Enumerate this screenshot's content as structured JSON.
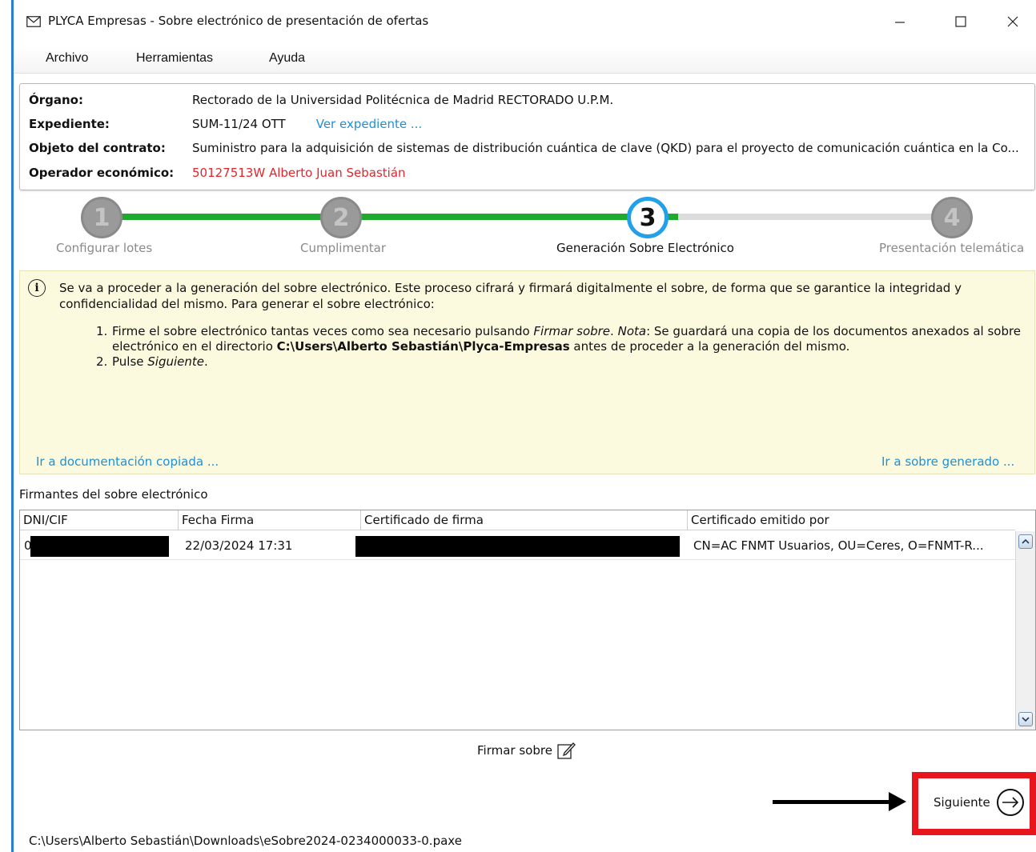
{
  "window": {
    "title": "PLYCA Empresas - Sobre electrónico de presentación de ofertas",
    "app_icon": "envelope-icon",
    "controls": [
      "minimize-icon",
      "maximize-icon",
      "close-icon"
    ]
  },
  "menu": {
    "items": [
      "Archivo",
      "Herramientas",
      "Ayuda"
    ]
  },
  "info": {
    "organo_label": "Órgano:",
    "organo_value": "Rectorado de la Universidad Politécnica de Madrid  RECTORADO U.P.M.",
    "expediente_label": "Expediente:",
    "expediente_value": "SUM-11/24 OTT",
    "expediente_link": "Ver expediente ...",
    "objeto_label": "Objeto del contrato:",
    "objeto_value": "Suministro para la adquisición de sistemas de distribución cuántica de clave (QKD) para el proyecto de comunicación cuántica en la Co...",
    "operador_label": "Operador económico:",
    "operador_value": "50127513W Alberto Juan Sebastián",
    "operador_color": "#e0262d"
  },
  "stepper": {
    "steps": [
      {
        "number": "1",
        "label": "Configurar lotes",
        "state": "done"
      },
      {
        "number": "2",
        "label": "Cumplimentar",
        "state": "done"
      },
      {
        "number": "3",
        "label": "Generación Sobre Electrónico",
        "state": "current"
      },
      {
        "number": "4",
        "label": "Presentación telemática",
        "state": "pending"
      }
    ],
    "progress_color": "#1faa2e",
    "current_color": "#22a0e8"
  },
  "notice": {
    "icon": "info-icon",
    "intro": "Se va a proceder a la generación del sobre electrónico. Este proceso cifrará y firmará digitalmente el sobre, de forma que se garantice la integridad y confidencialidad del mismo. Para generar el sobre electrónico:",
    "item1_num": "1.",
    "item1_a": "Firme el sobre electrónico tantas veces como sea necesario pulsando ",
    "item1_em1": "Firmar sobre",
    "item1_b": ". ",
    "item1_em2": "Nota",
    "item1_c": ": Se guardará una copia de los documentos anexados al sobre electrónico en el directorio ",
    "item1_path": "C:\\Users\\Alberto Sebastián\\Plyca-Empresas",
    "item1_d": " antes de proceder a la generación del mismo.",
    "item2_num": "2.",
    "item2_a": "Pulse ",
    "item2_em": "Siguiente",
    "item2_b": ".",
    "link_left": "Ir a documentación copiada ...",
    "link_right": "Ir a sobre generado ..."
  },
  "signers": {
    "title": "Firmantes del sobre electrónico",
    "columns": [
      "DNI/CIF",
      "Fecha Firma",
      "Certificado de firma",
      "Certificado emitido por"
    ],
    "rows": [
      {
        "dni": "0",
        "fecha": "22/03/2024 17:31",
        "certificado": "",
        "emisor": "CN=AC FNMT Usuarios, OU=Ceres, O=FNMT-R..."
      }
    ]
  },
  "actions": {
    "firmar_label": "Firmar sobre",
    "firmar_icon": "edit-icon",
    "siguiente_label": "Siguiente",
    "siguiente_icon": "arrow-right-icon"
  },
  "status": {
    "path": "C:\\Users\\Alberto Sebastián\\Downloads\\eSobre2024-0234000033-0.paxe"
  }
}
